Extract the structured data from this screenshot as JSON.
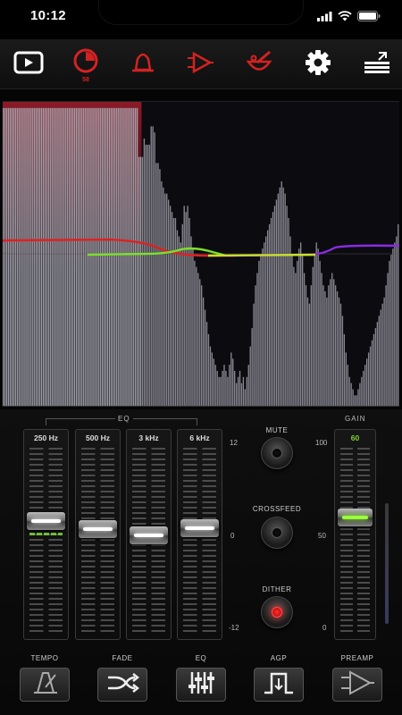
{
  "status_bar": {
    "time": "10:12"
  },
  "toolbar": {
    "items": [
      {
        "icon": "play-screen-icon",
        "color": "#ffffff"
      },
      {
        "icon": "timer-clock-icon",
        "color": "#d42222",
        "sublabel": "58"
      },
      {
        "icon": "bell-icon",
        "color": "#d42222"
      },
      {
        "icon": "amplifier-icon",
        "color": "#d42222"
      },
      {
        "icon": "mortar-pestle-icon",
        "color": "#d42222"
      },
      {
        "icon": "gear-icon",
        "color": "#ffffff"
      },
      {
        "icon": "menu-collapse-icon",
        "color": "#ffffff"
      }
    ]
  },
  "spectrum": {
    "bar_heights": [
      0.98,
      0.98,
      0.98,
      0.98,
      0.98,
      0.98,
      0.98,
      0.98,
      0.98,
      0.98,
      0.98,
      0.98,
      0.98,
      0.98,
      0.98,
      0.98,
      0.98,
      0.98,
      0.98,
      0.98,
      0.98,
      0.98,
      0.98,
      0.98,
      0.98,
      0.98,
      0.98,
      0.98,
      0.98,
      0.98,
      0.98,
      0.98,
      0.98,
      0.98,
      0.98,
      0.98,
      0.98,
      0.98,
      0.98,
      0.98,
      0.98,
      0.98,
      0.98,
      0.98,
      0.98,
      0.98,
      0.98,
      0.98,
      0.98,
      0.98,
      0.98,
      0.98,
      0.98,
      0.98,
      0.98,
      0.98,
      0.98,
      0.98,
      0.98,
      0.98,
      0.98,
      0.98,
      0.98,
      0.98,
      0.98,
      0.98,
      0.98,
      0.98,
      0.98,
      0.98,
      0.98,
      0.98,
      0.98,
      0.98,
      0.98,
      0.98,
      0.98,
      0.98,
      0.82,
      0.82,
      0.82,
      0.88,
      0.86,
      0.86,
      0.86,
      0.92,
      0.92,
      0.9,
      0.8,
      0.8,
      0.78,
      0.74,
      0.72,
      0.7,
      0.7,
      0.68,
      0.66,
      0.64,
      0.62,
      0.62,
      0.58,
      0.56,
      0.54,
      0.6,
      0.66,
      0.64,
      0.66,
      0.62,
      0.56,
      0.52,
      0.48,
      0.46,
      0.44,
      0.42,
      0.4,
      0.36,
      0.32,
      0.28,
      0.24,
      0.2,
      0.18,
      0.16,
      0.14,
      0.12,
      0.1,
      0.1,
      0.12,
      0.14,
      0.12,
      0.1,
      0.14,
      0.18,
      0.16,
      0.12,
      0.08,
      0.1,
      0.12,
      0.08,
      0.1,
      0.06,
      0.1,
      0.14,
      0.2,
      0.26,
      0.34,
      0.4,
      0.44,
      0.48,
      0.5,
      0.52,
      0.54,
      0.56,
      0.58,
      0.6,
      0.62,
      0.64,
      0.66,
      0.68,
      0.7,
      0.72,
      0.74,
      0.72,
      0.7,
      0.66,
      0.62,
      0.56,
      0.5,
      0.46,
      0.44,
      0.48,
      0.52,
      0.54,
      0.5,
      0.44,
      0.4,
      0.36,
      0.34,
      0.4,
      0.46,
      0.5,
      0.54,
      0.52,
      0.48,
      0.44,
      0.4,
      0.38,
      0.36,
      0.4,
      0.42,
      0.44,
      0.42,
      0.4,
      0.38,
      0.36,
      0.34,
      0.3,
      0.24,
      0.18,
      0.14,
      0.1,
      0.08,
      0.06,
      0.04,
      0.04,
      0.06,
      0.08,
      0.1,
      0.12,
      0.14,
      0.16,
      0.18,
      0.2,
      0.22,
      0.24,
      0.26,
      0.28,
      0.3,
      0.32,
      0.34,
      0.36,
      0.4,
      0.44,
      0.48,
      0.5,
      0.52,
      0.54,
      0.56,
      0.6
    ],
    "red_zone_fraction": 0.35,
    "curve_colors": {
      "left": "#e02020",
      "middle": "#7be02a",
      "right": "#8a2be2",
      "flat": "#c8e02a"
    }
  },
  "eq": {
    "title": "EQ",
    "bands": [
      {
        "label": "250 Hz",
        "value_db": 2
      },
      {
        "label": "500 Hz",
        "value_db": 0.8
      },
      {
        "label": "3 kHz",
        "value_db": 0
      },
      {
        "label": "6 kHz",
        "value_db": 1
      }
    ],
    "scale": {
      "top": "12",
      "mid": "0",
      "bottom": "-12"
    }
  },
  "switches": {
    "mute": {
      "label": "MUTE",
      "on": false
    },
    "crossfeed": {
      "label": "CROSSFEED",
      "on": false
    },
    "dither": {
      "label": "DITHER",
      "on": true
    }
  },
  "gain": {
    "title": "GAIN",
    "value": "60",
    "scale": {
      "top": "100",
      "mid": "50",
      "bottom": "0"
    }
  },
  "bottom": [
    {
      "label": "TEMPO",
      "icon": "tempo-metronome-icon"
    },
    {
      "label": "FADE",
      "icon": "crossfade-arrows-icon"
    },
    {
      "label": "EQ",
      "icon": "eq-sliders-icon"
    },
    {
      "label": "AGP",
      "icon": "agp-pulse-icon"
    },
    {
      "label": "PREAMP",
      "icon": "preamp-triangle-icon"
    }
  ]
}
